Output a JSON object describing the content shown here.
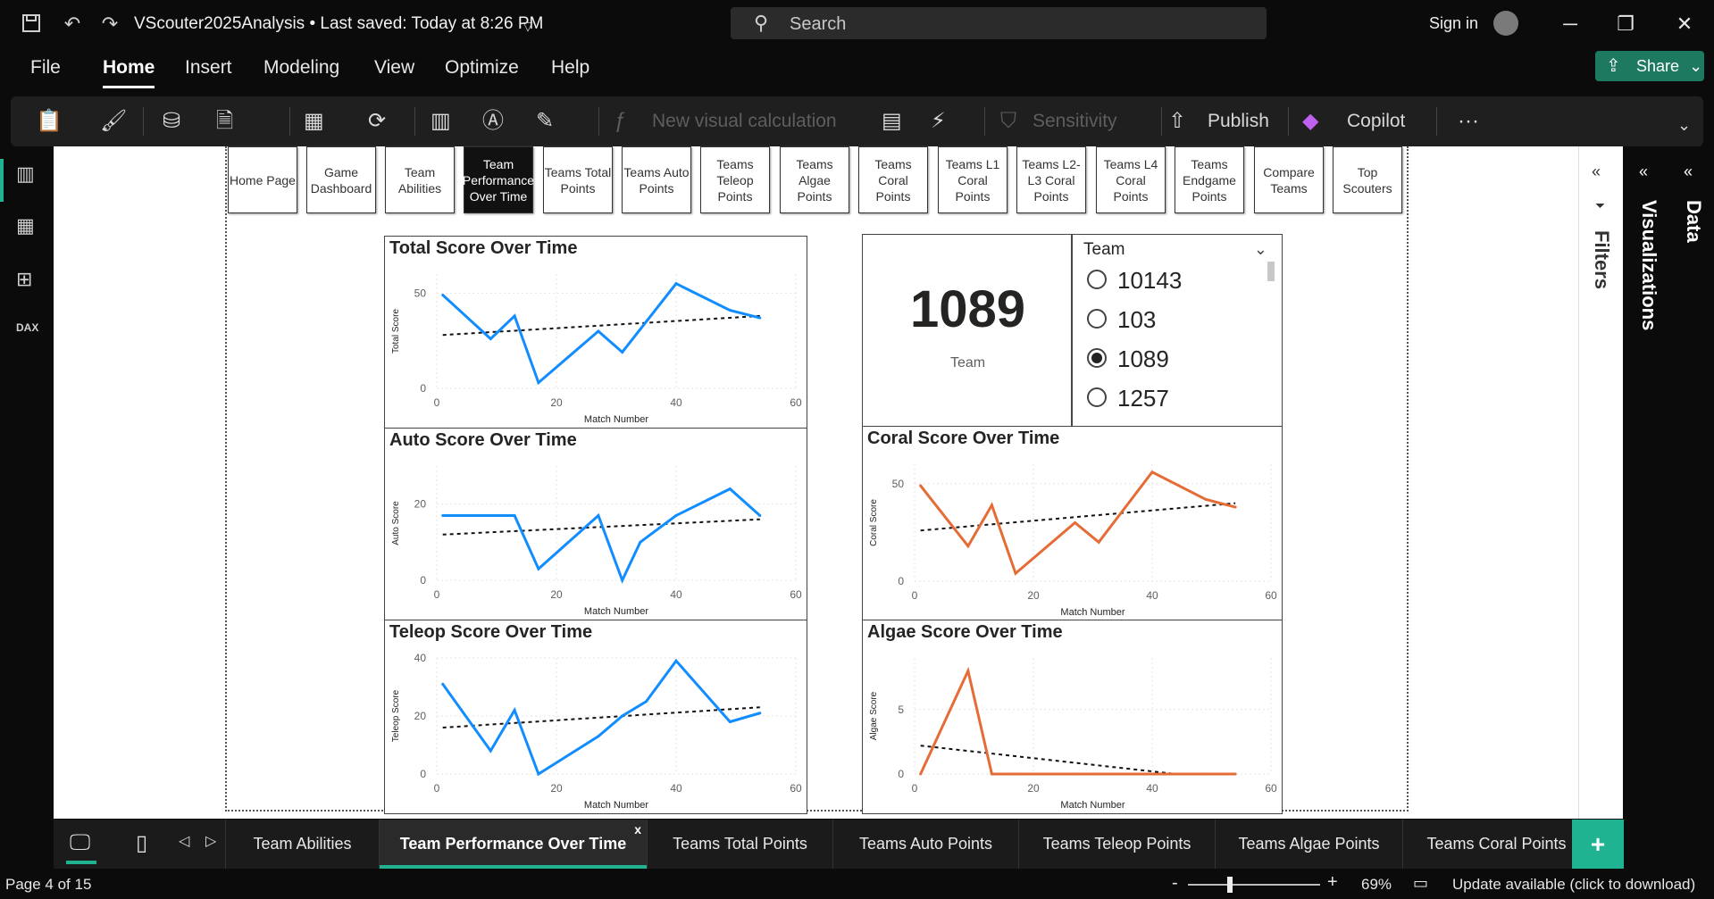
{
  "titlebar": {
    "title": "VScouter2025Analysis • Last saved: Today at 8:26 PM",
    "search_placeholder": "Search",
    "signin": "Sign in"
  },
  "menu": {
    "items": [
      "File",
      "Home",
      "Insert",
      "Modeling",
      "View",
      "Optimize",
      "Help"
    ],
    "active": "Home",
    "share": "Share"
  },
  "ribbon": {
    "new_visual_calc": "New visual calculation",
    "sensitivity": "Sensitivity",
    "publish": "Publish",
    "copilot": "Copilot",
    "more": "···"
  },
  "nav_buttons": [
    {
      "label": "Home Page"
    },
    {
      "label": "Game Dashboard"
    },
    {
      "label": "Team Abilities"
    },
    {
      "label": "Team Performance Over Time",
      "active": true
    },
    {
      "label": "Teams Total Points"
    },
    {
      "label": "Teams Auto Points"
    },
    {
      "label": "Teams Teleop Points"
    },
    {
      "label": "Teams Algae Points"
    },
    {
      "label": "Teams Coral Points"
    },
    {
      "label": "Teams L1 Coral Points"
    },
    {
      "label": "Teams L2-L3 Coral Points"
    },
    {
      "label": "Teams L4 Coral Points"
    },
    {
      "label": "Teams Endgame Points"
    },
    {
      "label": "Compare Teams"
    },
    {
      "label": "Top Scouters"
    }
  ],
  "kpi": {
    "value": "1089",
    "label": "Team"
  },
  "slicer": {
    "title": "Team",
    "options": [
      {
        "label": "10143",
        "selected": false
      },
      {
        "label": "103",
        "selected": false
      },
      {
        "label": "1089",
        "selected": true
      },
      {
        "label": "1257",
        "selected": false
      }
    ]
  },
  "chart_data": [
    {
      "id": "total",
      "type": "line",
      "title": "Total Score Over Time",
      "xlabel": "Match Number",
      "ylabel": "Total Score",
      "xlim": [
        0,
        60
      ],
      "ylim": [
        0,
        60
      ],
      "xticks": [
        0,
        20,
        40,
        60
      ],
      "yticks": [
        0,
        50
      ],
      "color": "#118DFF",
      "x": [
        1,
        9,
        13,
        17,
        27,
        31,
        40,
        49,
        54
      ],
      "y": [
        49,
        26,
        38,
        3,
        30,
        19,
        55,
        41,
        37
      ],
      "trend": [
        [
          1,
          28
        ],
        [
          54,
          38
        ]
      ]
    },
    {
      "id": "coral",
      "type": "line",
      "title": "Coral Score Over Time",
      "xlabel": "Match Number",
      "ylabel": "Coral Score",
      "xlim": [
        0,
        60
      ],
      "ylim": [
        0,
        60
      ],
      "xticks": [
        0,
        20,
        40,
        60
      ],
      "yticks": [
        0,
        50
      ],
      "color": "#E66C37",
      "x": [
        1,
        9,
        13,
        17,
        27,
        31,
        40,
        49,
        54
      ],
      "y": [
        49,
        18,
        39,
        4,
        30,
        20,
        56,
        42,
        38
      ],
      "trend": [
        [
          1,
          26
        ],
        [
          54,
          40
        ]
      ]
    },
    {
      "id": "auto",
      "type": "line",
      "title": "Auto Score Over Time",
      "xlabel": "Match Number",
      "ylabel": "Auto Score",
      "xlim": [
        0,
        60
      ],
      "ylim": [
        0,
        30
      ],
      "xticks": [
        0,
        20,
        40,
        60
      ],
      "yticks": [
        0,
        20
      ],
      "color": "#118DFF",
      "x": [
        1,
        9,
        13,
        17,
        27,
        31,
        34,
        40,
        49,
        54
      ],
      "y": [
        17,
        17,
        17,
        3,
        17,
        0,
        10,
        17,
        24,
        17
      ],
      "trend": [
        [
          1,
          12
        ],
        [
          54,
          16
        ]
      ]
    },
    {
      "id": "algae",
      "type": "line",
      "title": "Algae Score Over Time",
      "xlabel": "Match Number",
      "ylabel": "Algae Score",
      "xlim": [
        0,
        60
      ],
      "ylim": [
        0,
        9
      ],
      "xticks": [
        0,
        20,
        40,
        60
      ],
      "yticks": [
        0,
        5
      ],
      "color": "#E66C37",
      "x": [
        1,
        9,
        13,
        17,
        27,
        31,
        40,
        49,
        54
      ],
      "y": [
        0,
        8,
        0,
        0,
        0,
        0,
        0,
        0,
        0
      ],
      "trend": [
        [
          1,
          2.2
        ],
        [
          44,
          0
        ]
      ]
    },
    {
      "id": "teleop",
      "type": "line",
      "title": "Teleop Score Over Time",
      "xlabel": "Match Number",
      "ylabel": "Teleop Score",
      "xlim": [
        0,
        60
      ],
      "ylim": [
        0,
        40
      ],
      "xticks": [
        0,
        20,
        40,
        60
      ],
      "yticks": [
        0,
        20,
        40
      ],
      "color": "#118DFF",
      "x": [
        1,
        9,
        13,
        17,
        27,
        31,
        35,
        40,
        49,
        54
      ],
      "y": [
        31,
        8,
        22,
        0,
        13,
        20,
        25,
        39,
        18,
        21
      ],
      "trend": [
        [
          1,
          16
        ],
        [
          54,
          23
        ]
      ]
    }
  ],
  "rightpanels": {
    "filters": "Filters",
    "visualizations": "Visualizations",
    "data": "Data"
  },
  "tabs": {
    "items": [
      "Team Abilities",
      "Team Performance Over Time",
      "Teams Total Points",
      "Teams Auto Points",
      "Teams Teleop Points",
      "Teams Algae Points",
      "Teams Coral Points"
    ],
    "active": "Team Performance Over Time",
    "close": "x",
    "add": "+"
  },
  "status": {
    "page": "Page 4 of 15",
    "zoom": "69%",
    "update": "Update available (click to download)"
  }
}
